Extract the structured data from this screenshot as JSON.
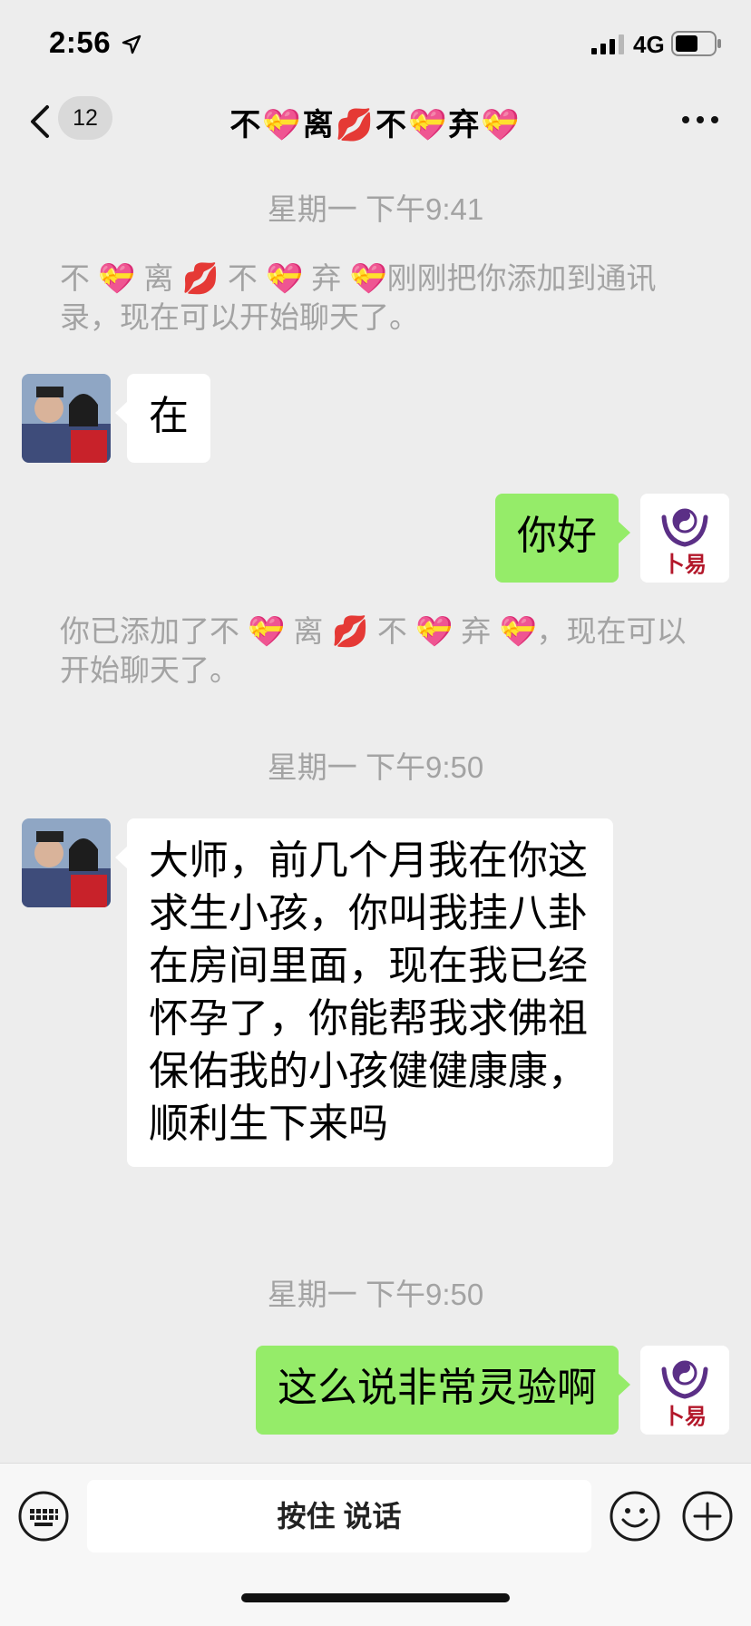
{
  "status_bar": {
    "time": "2:56",
    "network": "4G"
  },
  "nav": {
    "unread_count": "12",
    "title": "不💝离💋不💝弃💝"
  },
  "messages": [
    {
      "type": "time",
      "text": "星期一 下午9:41"
    },
    {
      "type": "system",
      "text": "不 💝 离 💋 不 💝 弃 💝刚刚把你添加到通讯录，现在可以开始聊天了。"
    },
    {
      "type": "incoming",
      "text": "在"
    },
    {
      "type": "outgoing",
      "text": "你好"
    },
    {
      "type": "system",
      "text": "你已添加了不 💝 离 💋 不 💝 弃 💝，现在可以开始聊天了。"
    },
    {
      "type": "time",
      "text": "星期一 下午9:50"
    },
    {
      "type": "incoming",
      "text": "大师，前几个月我在你这求生小孩，你叫我挂八卦在房间里面，现在我已经怀孕了，你能帮我求佛祖保佑我的小孩健健康康，顺利生下来吗"
    },
    {
      "type": "time",
      "text": "星期一 下午9:50"
    },
    {
      "type": "outgoing",
      "text": "这么说非常灵验啊"
    }
  ],
  "my_avatar": {
    "logo_text": "卜易"
  },
  "input_bar": {
    "voice_label": "按住 说话"
  },
  "colors": {
    "outgoing_bubble": "#95ec69",
    "incoming_bubble": "#ffffff",
    "background": "#ededed"
  },
  "icons": [
    "location-arrow-icon",
    "signal-icon",
    "battery-icon",
    "back-chevron-icon",
    "more-icon",
    "keyboard-icon",
    "emoji-icon",
    "plus-icon"
  ]
}
